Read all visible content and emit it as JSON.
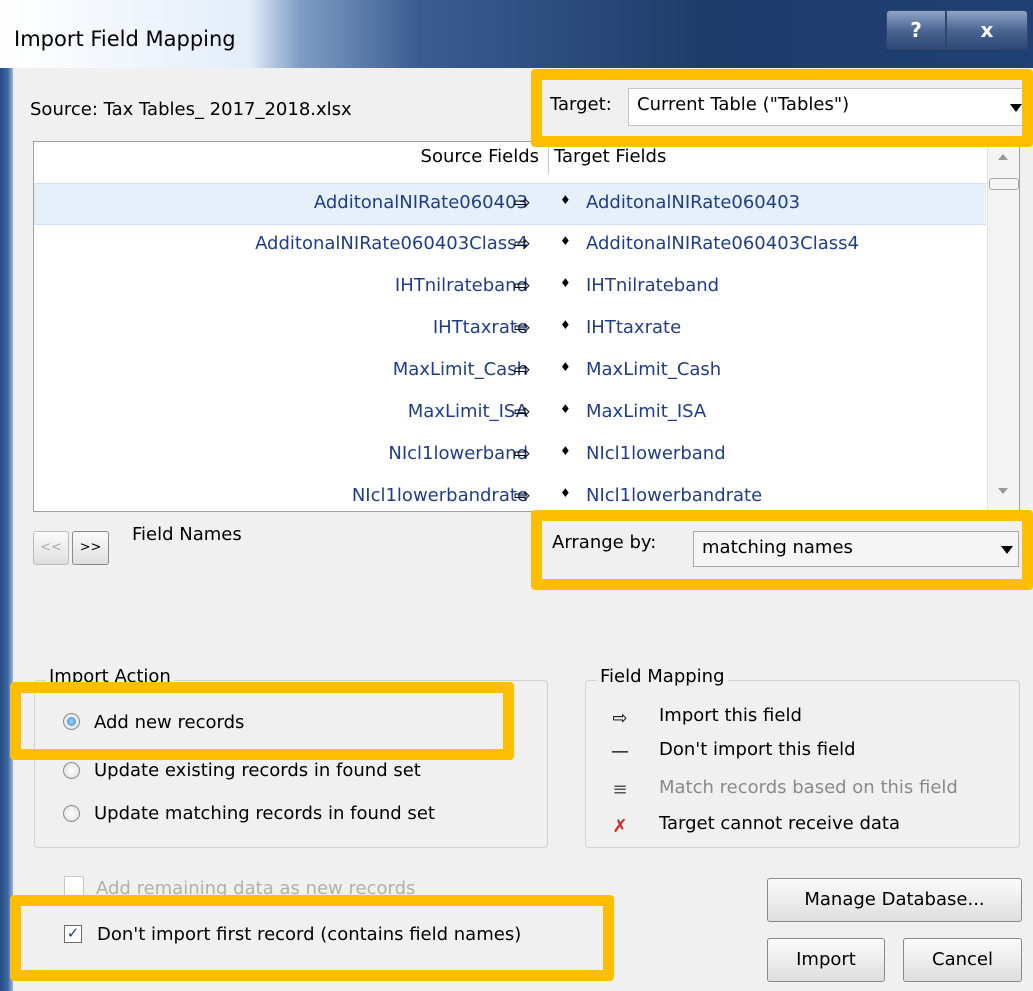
{
  "window": {
    "title": "Import Field Mapping",
    "help_label": "?",
    "close_label": "x"
  },
  "source_label": "Source: Tax Tables_ 2017_2018.xlsx",
  "target": {
    "label": "Target:",
    "value": "Current Table (\"Tables\")"
  },
  "field_list": {
    "source_header": "Source Fields",
    "target_header": "Target Fields",
    "map_symbol": "⇨",
    "match_symbol": "♦",
    "rows": [
      {
        "source": "AdditonalNIRate060403",
        "target": "AdditonalNIRate060403",
        "selected": true
      },
      {
        "source": "AdditonalNIRate060403Class4",
        "target": "AdditonalNIRate060403Class4"
      },
      {
        "source": "IHTnilrateband",
        "target": "IHTnilrateband"
      },
      {
        "source": "IHTtaxrate",
        "target": "IHTtaxrate"
      },
      {
        "source": "MaxLimit_Cash",
        "target": "MaxLimit_Cash"
      },
      {
        "source": "MaxLimit_ISA",
        "target": "MaxLimit_ISA"
      },
      {
        "source": "NIcl1lowerband",
        "target": "NIcl1lowerband"
      },
      {
        "source": "NIcl1lowerbandrate",
        "target": "NIcl1lowerbandrate"
      }
    ]
  },
  "record_nav": {
    "prev_label": "<<",
    "next_label": ">>",
    "field_names_label": "Field Names"
  },
  "arrange": {
    "label": "Arrange by:",
    "value": "matching names"
  },
  "import_action": {
    "title": "Import Action",
    "options": [
      {
        "label": "Add new records",
        "selected": true
      },
      {
        "label": "Update existing records in found set",
        "selected": false
      },
      {
        "label": "Update matching records in found set",
        "selected": false
      }
    ]
  },
  "field_mapping": {
    "title": "Field Mapping",
    "items": [
      {
        "icon": "⇨",
        "label": "Import this field"
      },
      {
        "icon": "—",
        "label": "Don't import this field"
      },
      {
        "icon": "≡",
        "label": "Match records based on this field"
      },
      {
        "icon": "✗",
        "label": "Target cannot receive data"
      }
    ]
  },
  "add_remaining_label": "Add remaining data as new records",
  "dont_import_first": {
    "label": "Don't import first record (contains field names)",
    "checked": true,
    "check_glyph": "✓"
  },
  "buttons": {
    "manage": "Manage Database...",
    "import": "Import",
    "cancel": "Cancel"
  },
  "colors": {
    "highlight": "#ffbf00",
    "field_text": "#1f3d8a",
    "title_bar": "#1e3c6c"
  }
}
